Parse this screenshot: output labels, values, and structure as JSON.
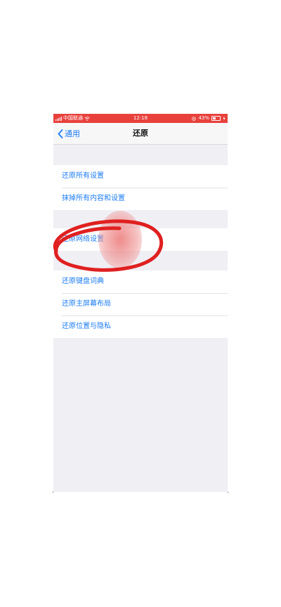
{
  "status_bar": {
    "carrier": "中国联通",
    "time": "12:18",
    "battery": "43%",
    "wifi_icon": "wifi-icon",
    "battery_icon": "battery-icon",
    "bg_color": "#e8413c"
  },
  "nav": {
    "back_label": "通用",
    "title": "还原"
  },
  "groups": [
    {
      "items": [
        {
          "label": "还原所有设置"
        },
        {
          "label": "抹掉所有内容和设置"
        }
      ]
    },
    {
      "items": [
        {
          "label": "还原网络设置"
        }
      ]
    },
    {
      "items": [
        {
          "label": "还原键盘词典"
        },
        {
          "label": "还原主屏幕布局"
        },
        {
          "label": "还原位置与隐私"
        }
      ]
    }
  ],
  "accent_color": "#1d7cf2",
  "annotation_color": "#e02020"
}
